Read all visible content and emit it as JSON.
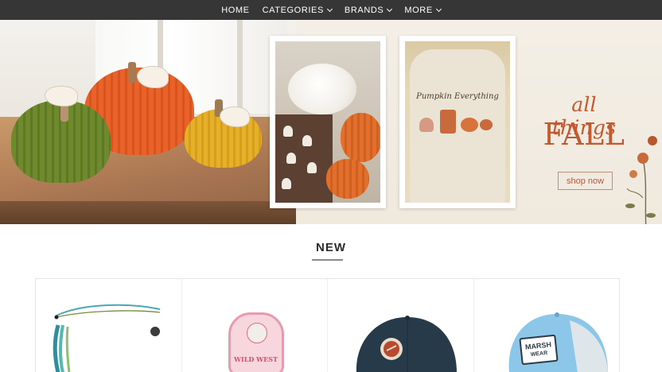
{
  "nav": {
    "items": [
      {
        "label": "HOME",
        "has_dropdown": false
      },
      {
        "label": "CATEGORIES",
        "has_dropdown": true
      },
      {
        "label": "BRANDS",
        "has_dropdown": true
      },
      {
        "label": "MORE",
        "has_dropdown": true
      }
    ]
  },
  "hero": {
    "headline_line1": "all things",
    "headline_line2": "FALL",
    "cta_label": "shop now",
    "shirt_text": "Pumpkin Everything",
    "colors": {
      "accent": "#c2592f",
      "nav_bg": "#363636"
    }
  },
  "new_section": {
    "heading": "NEW"
  },
  "products": [
    {
      "name_icon": "bracelet-product-image"
    },
    {
      "name_icon": "sticker-product-image",
      "sticker_text": "WILD WEST"
    },
    {
      "name_icon": "navy-cap-product-image"
    },
    {
      "name_icon": "trucker-cap-product-image",
      "patch_line1": "MARSH",
      "patch_line2": "WEAR"
    }
  ]
}
